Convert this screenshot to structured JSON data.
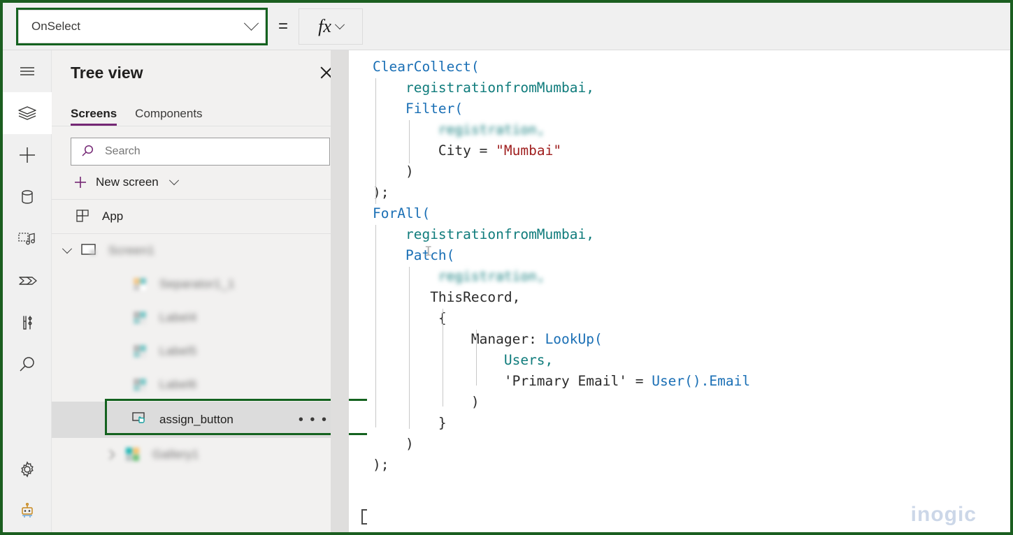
{
  "window": {
    "annotation_border_color": "#1b5e20"
  },
  "formula_bar": {
    "property_selected": "OnSelect",
    "equals_sign": "=",
    "fx_label": "fx",
    "dropdown_icon": "chevron-down-icon",
    "highlighted": true
  },
  "rail": {
    "items": [
      {
        "name": "hamburger-menu-icon",
        "label": "Menu",
        "active": false
      },
      {
        "name": "layers-icon",
        "label": "Tree view",
        "active": true
      },
      {
        "name": "plus-icon",
        "label": "Insert",
        "active": false
      },
      {
        "name": "database-icon",
        "label": "Data",
        "active": false
      },
      {
        "name": "media-icon",
        "label": "Media",
        "active": false
      },
      {
        "name": "power-automate-icon",
        "label": "Power Automate",
        "active": false
      },
      {
        "name": "variables-icon",
        "label": "Variables",
        "active": false
      },
      {
        "name": "search-icon",
        "label": "Search",
        "active": false
      }
    ],
    "bottom_items": [
      {
        "name": "gear-icon",
        "label": "Settings"
      },
      {
        "name": "copilot-robot-icon",
        "label": "Copilot"
      }
    ]
  },
  "tree_view": {
    "title": "Tree view",
    "close_icon": "close-icon",
    "tabs": [
      {
        "label": "Screens",
        "active": true
      },
      {
        "label": "Components",
        "active": false
      }
    ],
    "search": {
      "placeholder": "Search",
      "value": "",
      "icon": "search-icon"
    },
    "new_screen": {
      "label": "New screen",
      "plus_icon": "plus-icon",
      "chevron_icon": "chevron-down-icon"
    },
    "items": [
      {
        "label": "App",
        "icon": "app-grid-icon",
        "indent": 0,
        "blurred": false,
        "selected": false,
        "expander": "none"
      },
      {
        "label": "Screen1",
        "icon": "screen-icon",
        "indent": 0,
        "blurred": true,
        "selected": false,
        "expander": "expanded"
      },
      {
        "label": "Separator1_1",
        "icon": "image-control-icon",
        "indent": 1,
        "blurred": true,
        "selected": false,
        "expander": "none"
      },
      {
        "label": "Label4",
        "icon": "label-control-icon",
        "indent": 1,
        "blurred": true,
        "selected": false,
        "expander": "none"
      },
      {
        "label": "Label5",
        "icon": "label-control-icon",
        "indent": 1,
        "blurred": true,
        "selected": false,
        "expander": "none"
      },
      {
        "label": "Label6",
        "icon": "label-control-icon",
        "indent": 1,
        "blurred": true,
        "selected": false,
        "expander": "none"
      },
      {
        "label": "assign_button",
        "icon": "button-control-icon",
        "indent": 1,
        "blurred": false,
        "selected": true,
        "expander": "none",
        "overflow_menu": "• • •"
      },
      {
        "label": "Gallery1",
        "icon": "gallery-control-icon",
        "indent": 1,
        "blurred": true,
        "selected": false,
        "expander": "collapsed"
      }
    ]
  },
  "code_editor": {
    "language": "PowerFx",
    "formula_text": "ClearCollect(\n    registrationfromMumbai,\n    Filter(\n        registration,\n        City = \"Mumbai\"\n    )\n);\nForAll(\n    registrationfromMumbai,\n    Patch(\n        registration,\n        ThisRecord,\n        {\n            Manager: LookUp(\n                Users,\n                'Primary Email' = User().Email\n            )\n        }\n    )\n);",
    "tokens": {
      "clear_collect": "ClearCollect(",
      "collection_name": "registrationfromMumbai,",
      "filter": "Filter(",
      "table_blurred": "registration,",
      "city_field": "City",
      "equals": "=",
      "mumbai_string": "\"Mumbai\"",
      "close_paren": ")",
      "statement_end": ");",
      "forall": "ForAll(",
      "patch": "Patch(",
      "this_record": "ThisRecord,",
      "open_brace": "{",
      "manager_key": "Manager:",
      "lookup": "LookUp(",
      "users": "Users,",
      "primary_email": "'Primary Email'",
      "user_email": "User().Email",
      "close_brace": "}"
    },
    "colors": {
      "function": "#1a6fb5",
      "table": "#107c7c",
      "string": "#a02020",
      "plain": "#2b2b2b"
    }
  },
  "watermark": {
    "text_before": "in",
    "text_after": "gic",
    "full": "inogic",
    "color": "#ccd7e8"
  }
}
